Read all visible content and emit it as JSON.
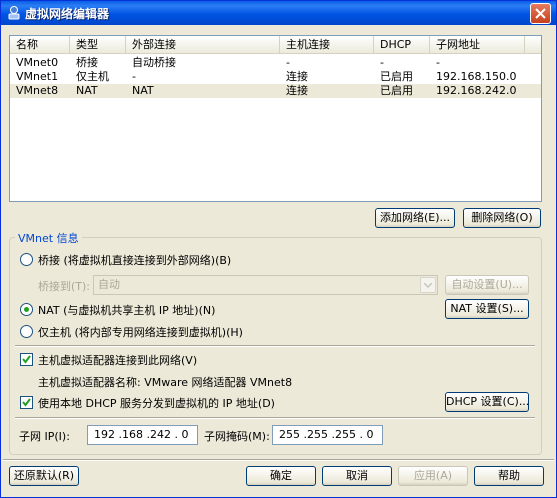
{
  "window": {
    "title": "虚拟网络编辑器"
  },
  "list": {
    "columns": [
      "名称",
      "类型",
      "外部连接",
      "主机连接",
      "DHCP",
      "子网地址"
    ],
    "rows": [
      [
        "VMnet0",
        "桥接",
        "自动桥接",
        "-",
        "-",
        "-"
      ],
      [
        "VMnet1",
        "仅主机",
        "-",
        "连接",
        "已启用",
        "192.168.150.0"
      ],
      [
        "VMnet8",
        "NAT",
        "NAT",
        "连接",
        "已启用",
        "192.168.242.0"
      ]
    ],
    "selected_index": 2
  },
  "buttons": {
    "add_network": "添加网络(E)...",
    "remove_network": "删除网络(O)",
    "auto_settings": "自动设置(U)...",
    "nat_settings": "NAT 设置(S)...",
    "dhcp_settings": "DHCP 设置(C)...",
    "restore_defaults": "还原默认(R)",
    "ok": "确定",
    "cancel": "取消",
    "apply": "应用(A)",
    "help": "帮助"
  },
  "vmnet_info": {
    "group_title": "VMnet 信息",
    "bridged_label": "桥接 (将虚拟机直接连接到外部网络)(B)",
    "bridged_to_label": "桥接到(T):",
    "bridged_to_value": "自动",
    "nat_label": "NAT (与虚拟机共享主机 IP 地址)(N)",
    "hostonly_label": "仅主机 (将内部专用网络连接到虚拟机)(H)",
    "selected_mode": "nat",
    "connect_adapter_label": "主机虚拟适配器连接到此网络(V)",
    "connect_adapter_checked": true,
    "adapter_name_text": "主机虚拟适配器名称: VMware 网络适配器 VMnet8",
    "use_dhcp_label": "使用本地 DHCP 服务分发到虚拟机的 IP 地址(D)",
    "use_dhcp_checked": true,
    "subnet_ip_label": "子网 IP(I):",
    "subnet_ip_value": "192 .168 .242 . 0",
    "subnet_mask_label": "子网掩码(M):",
    "subnet_mask_value": "255 .255 .255 . 0"
  },
  "colors": {
    "titlebar": "#0054e3",
    "group_title": "#0046d5",
    "radio_dot": "#21a121",
    "check_mark": "#21a121"
  }
}
